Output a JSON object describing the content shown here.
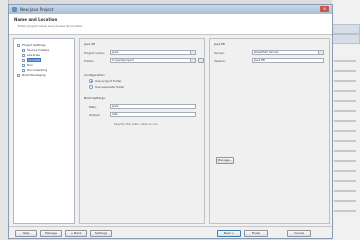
{
  "window": {
    "title": "New Java Project",
    "close_label": "×"
  },
  "header": {
    "title": "Name and Location",
    "description": "Enter project name and choose its location"
  },
  "tree": {
    "items": [
      {
        "label": "Project Settings",
        "selected": false
      },
      {
        "label": "Source Folders",
        "selected": false
      },
      {
        "label": "Libraries",
        "selected": false
      },
      {
        "label": "Compile",
        "selected": true
      },
      {
        "label": "Run",
        "selected": false
      },
      {
        "label": "Documenting",
        "selected": false
      },
      {
        "label": "Build Packaging",
        "selected": false
      }
    ]
  },
  "left_panel": {
    "section_title": "Java SE",
    "project_name_label": "Project name:",
    "project_name_value": "Java",
    "location_label": "Folder:",
    "location_value": "C:\\java\\project",
    "options_title": "Configuration:",
    "radio_1_label": "Use project folder",
    "radio_2_label": "Use separate folder",
    "build_title": "Build Settings:",
    "main_class_label": "Main:",
    "main_class_value": "Java",
    "output_label": "Output:",
    "output_value": "dist",
    "hint_text": "Specify the main class to run"
  },
  "right_panel": {
    "section_title": "Java EE",
    "server_label": "Server:",
    "server_value": "GlassFish Server",
    "version_label": "Version:",
    "version_value": "Java EE",
    "manage_button": "Manage..."
  },
  "footer": {
    "help_button": "Help",
    "manage_button": "Manage",
    "back_button": "< Back",
    "settings_button": "Settings",
    "next_button": "Next >",
    "finish_button": "Finish",
    "cancel_button": "Cancel"
  }
}
